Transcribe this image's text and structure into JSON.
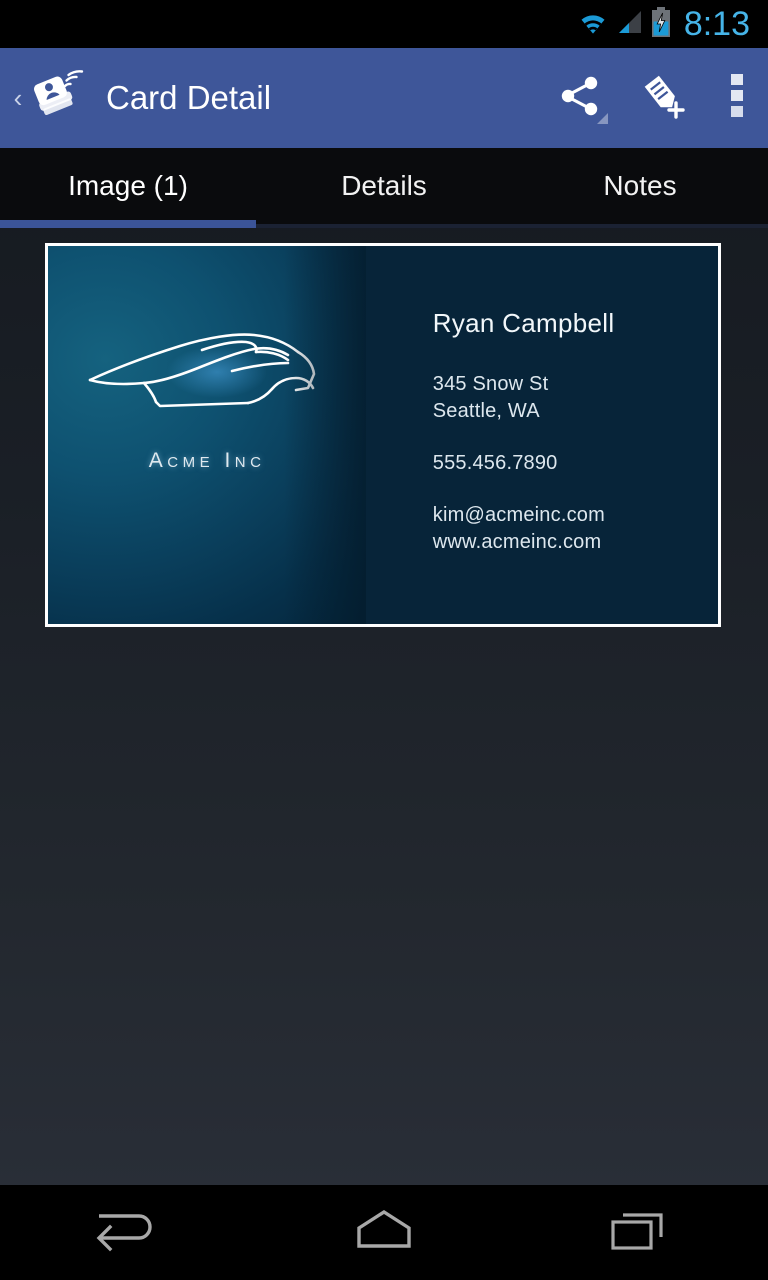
{
  "status_bar": {
    "time": "8:13",
    "icons": [
      "wifi-icon",
      "cellular-signal-icon",
      "battery-charging-icon"
    ],
    "time_color": "#46b4e8"
  },
  "action_bar": {
    "background": "#3e5699",
    "up_chevron": "‹",
    "logo_icon": "card-scanner-app-icon",
    "title": "Card Detail",
    "actions": [
      {
        "name": "share-icon",
        "label": "Share",
        "has_dropdown": true
      },
      {
        "name": "edit-tag-add-icon",
        "label": "Add Tag",
        "has_dropdown": false
      },
      {
        "name": "overflow-menu-icon",
        "label": "More options",
        "has_dropdown": false
      }
    ]
  },
  "tabs": {
    "items": [
      {
        "label": "Image (1)",
        "selected": true
      },
      {
        "label": "Details",
        "selected": false
      },
      {
        "label": "Notes",
        "selected": false
      }
    ],
    "indicator_color": "#3b5498"
  },
  "card": {
    "logo_icon": "sports-car-outline-icon",
    "company": "Acme Inc",
    "name": "Ryan Campbell",
    "address_line1": "345 Snow St",
    "address_line2": "Seattle, WA",
    "phone": "555.456.7890",
    "email": "kim@acmeinc.com",
    "website": "www.acmeinc.com",
    "left_panel_color": "#0e5170",
    "right_panel_color": "#072439",
    "border_color": "#ffffff"
  },
  "nav_bar": {
    "buttons": [
      {
        "name": "back-button",
        "label": "Back"
      },
      {
        "name": "home-button",
        "label": "Home"
      },
      {
        "name": "recents-button",
        "label": "Recent apps"
      }
    ]
  }
}
